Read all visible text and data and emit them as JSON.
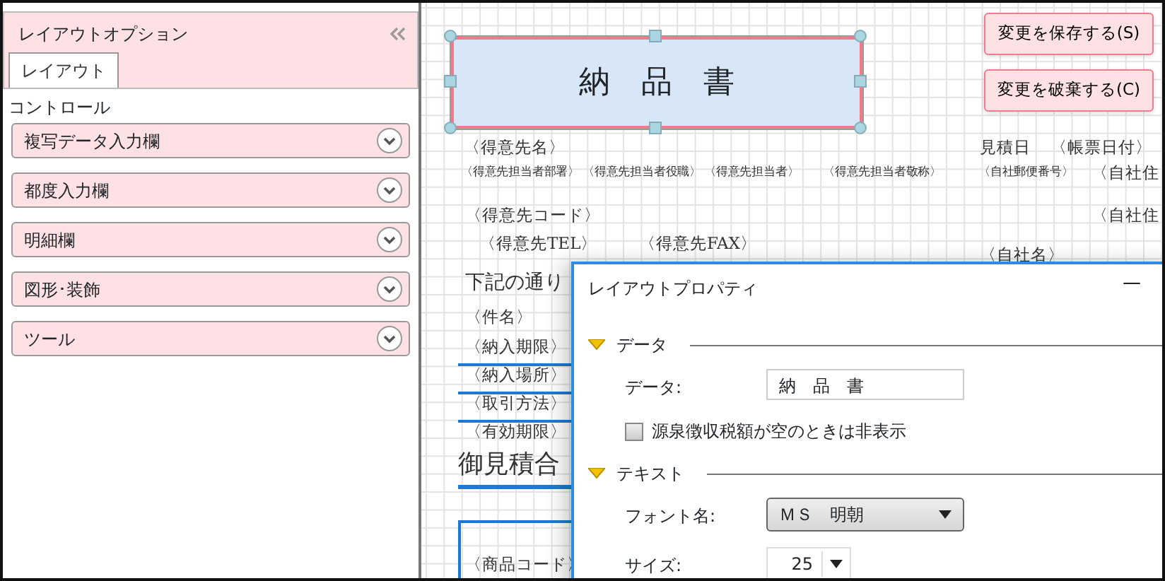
{
  "panel": {
    "title": "レイアウトオプション",
    "tabs": [
      {
        "label": "レイアウト",
        "selected": true
      }
    ],
    "section_label": "コントロール",
    "items": [
      {
        "label": "複写データ入力欄",
        "expanded": false
      },
      {
        "label": "都度入力欄",
        "expanded": false
      },
      {
        "label": "明細欄",
        "expanded": false
      },
      {
        "label": "図形･装飾",
        "expanded": false
      },
      {
        "label": "ツール",
        "expanded": false
      }
    ]
  },
  "canvas": {
    "title_box": {
      "text": "納　品　書",
      "selected": true
    },
    "buttons": [
      "変更を保存する(S)",
      "変更を破棄する(C)"
    ],
    "fields": [
      {
        "text": "〈得意先名〉",
        "kind": "medium"
      },
      {
        "text": "〈得意先担当者部署〉",
        "kind": "small"
      },
      {
        "text": "〈得意先担当者役職〉",
        "kind": "small"
      },
      {
        "text": "〈得意先担当者〉",
        "kind": "small"
      },
      {
        "text": "〈得意先担当者敬称〉",
        "kind": "small"
      },
      {
        "text": "見積日",
        "kind": "medium"
      },
      {
        "text": "〈帳票日付〉",
        "kind": "medium"
      },
      {
        "text": "〈自社郵便番号〉",
        "kind": "small"
      },
      {
        "text": "〈自社住",
        "kind": "medium"
      },
      {
        "text": "〈得意先コード〉",
        "kind": "medium"
      },
      {
        "text": "〈自社住",
        "kind": "medium"
      },
      {
        "text": "〈得意先TEL〉",
        "kind": "medium"
      },
      {
        "text": "〈得意先FAX〉",
        "kind": "medium"
      },
      {
        "text": "〈自社名〉",
        "kind": "medium"
      },
      {
        "text": "下記の通り",
        "kind": "large"
      },
      {
        "text": "〈件名〉",
        "kind": "medium"
      },
      {
        "text": "〈納入期限〉",
        "kind": "medium"
      },
      {
        "text": "〈納入場所〉",
        "kind": "medium"
      },
      {
        "text": "〈取引方法〉",
        "kind": "medium"
      },
      {
        "text": "〈有効期限〉",
        "kind": "medium"
      },
      {
        "text": "御見積合",
        "kind": "xlarge"
      },
      {
        "text": "〈商品コード〉",
        "kind": "medium"
      }
    ]
  },
  "dialog": {
    "title": "レイアウトプロパティ",
    "minimize": "—",
    "sections": [
      {
        "title": "データ",
        "expanded": true,
        "rows": [
          {
            "kind": "text",
            "label": "データ:",
            "value": "納　品　書"
          },
          {
            "kind": "checkbox",
            "label": "源泉徴収税額が空のときは非表示",
            "checked": false
          }
        ]
      },
      {
        "title": "テキスト",
        "expanded": true,
        "rows": [
          {
            "kind": "select",
            "label": "フォント名:",
            "value": "ＭＳ　明朝"
          },
          {
            "kind": "spin",
            "label": "サイズ:",
            "value": "25"
          }
        ]
      }
    ]
  }
}
